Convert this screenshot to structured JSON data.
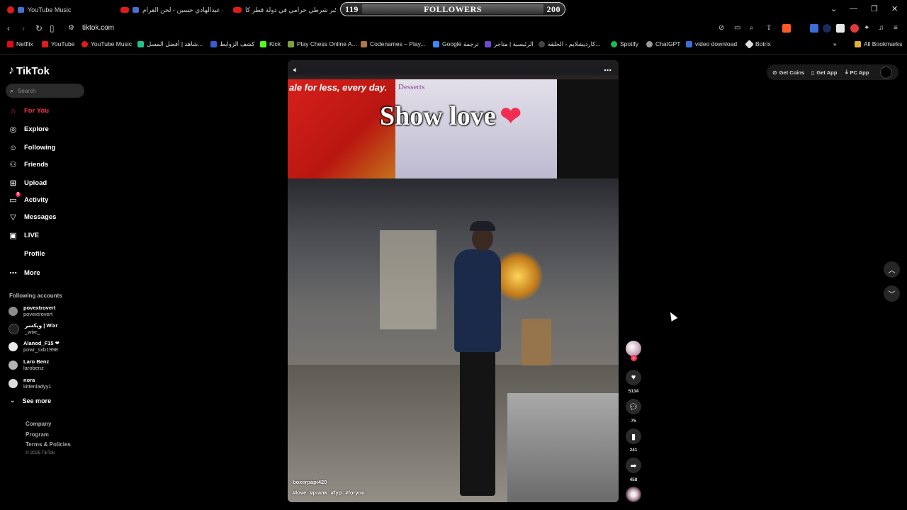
{
  "browser": {
    "tabs": [
      {
        "label": "YouTube Music"
      },
      {
        "label": "عبدالهادي حسين - لحن الغرام - be"
      },
      {
        "label": "اكبر شرطي حرامي في دولة قطر كا..."
      }
    ],
    "counter": {
      "left": "119",
      "label": "FOLLOWERS",
      "right": "200"
    },
    "url": "tiktok.com",
    "bookmarks": [
      "Netflix",
      "YouTube",
      "YouTube Music",
      "شاهد | أفضل المسل...",
      "كشف الزوابط",
      "Kick",
      "Play Chess Online A...",
      "Codenames – Play...",
      "Google ترجمة",
      "الرئيسية | متاجر",
      "كارديشلايم - الحلقة...",
      "Spotify",
      "ChatGPT",
      "video download",
      "Botrix"
    ],
    "all_bookmarks": "All Bookmarks",
    "colors": {
      "accent": "#fe2c55",
      "background": "#000000"
    }
  },
  "tiktok": {
    "logo": "TikTok",
    "search_placeholder": "Search",
    "nav": [
      {
        "label": "For You",
        "icon": "home-icon",
        "active": true
      },
      {
        "label": "Explore",
        "icon": "compass-icon"
      },
      {
        "label": "Following",
        "icon": "following-icon"
      },
      {
        "label": "Friends",
        "icon": "friends-icon"
      },
      {
        "label": "Upload",
        "icon": "upload-icon"
      },
      {
        "label": "Activity",
        "icon": "activity-icon",
        "badge": "3"
      },
      {
        "label": "Messages",
        "icon": "messages-icon"
      },
      {
        "label": "LIVE",
        "icon": "live-icon"
      },
      {
        "label": "Profile",
        "icon": "profile-icon"
      },
      {
        "label": "More",
        "icon": "more-icon"
      }
    ],
    "following_title": "Following accounts",
    "accounts": [
      {
        "name": "povextrovert",
        "handle": "povextrovert"
      },
      {
        "name": "ويكسر | Wixr",
        "handle": "_wixr_"
      },
      {
        "name": "Alanod_F15 ❤",
        "handle": "powr_sxb1998"
      },
      {
        "name": "Laro Benz",
        "handle": "larobenz"
      },
      {
        "name": "nora",
        "handle": "kittenladyy1"
      }
    ],
    "see_more": "See more",
    "footer": [
      "Company",
      "Program",
      "Terms & Policies"
    ],
    "copyright": "© 2025 TikTok",
    "actions": {
      "coins": "Get Coins",
      "app": "Get App",
      "pc": "PC App"
    },
    "video": {
      "overlay_text": "Show love",
      "promo_text": "ale for less, every day.",
      "board_title": "Desserts",
      "author": "boxerpapi420",
      "tags": [
        "#love",
        "#prank",
        "#fyp",
        "#foryou"
      ]
    },
    "stats": {
      "likes": "5134",
      "comments": "75",
      "saves": "241",
      "shares": "458"
    }
  }
}
